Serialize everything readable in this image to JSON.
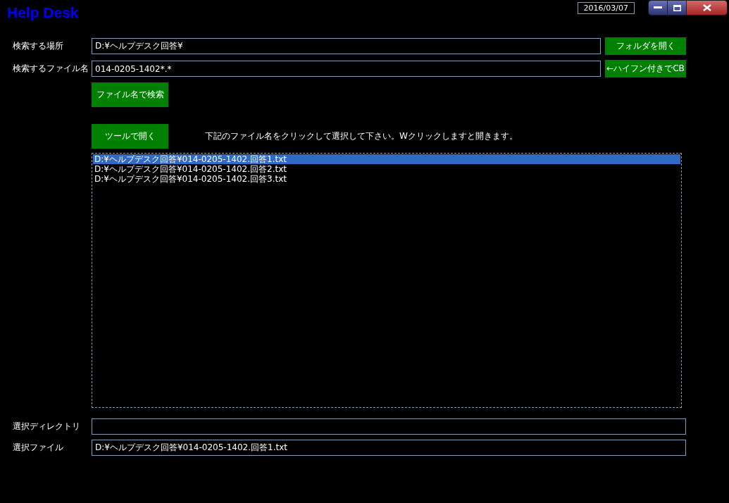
{
  "window": {
    "title": "Help Desk",
    "date": "2016/03/07"
  },
  "search": {
    "location": {
      "label": "検索する場所",
      "value": "D:¥ヘルプデスク回答¥"
    },
    "open_folder_button": "フォルダを開く",
    "filename": {
      "label": "検索するファイル名",
      "value": "014-0205-1402*.*"
    },
    "copy_button": "←ハイフン付きでCB",
    "search_button": "ファイル名で検索"
  },
  "open_tool_button": "ツールで開く",
  "instruction": "下記のファイル名をクリックして選択して下さい。Wクリックしますと開きます。",
  "files": [
    {
      "path": "D:¥ヘルプデスク回答¥014-0205-1402.回答1.txt",
      "selected": true
    },
    {
      "path": "D:¥ヘルプデスク回答¥014-0205-1402.回答2.txt",
      "selected": false
    },
    {
      "path": "D:¥ヘルプデスク回答¥014-0205-1402.回答3.txt",
      "selected": false
    }
  ],
  "selected_directory": {
    "label": "選択ディレクトリ"
  },
  "selected_file": {
    "label": "選択ファイル",
    "value": "D:¥ヘルプデスク回答¥014-0205-1402.回答1.txt"
  }
}
